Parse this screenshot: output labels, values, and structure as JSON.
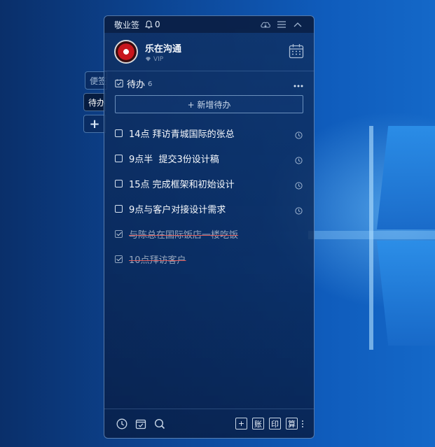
{
  "side_tabs": [
    {
      "label": "便签"
    },
    {
      "label": "待办"
    },
    {
      "label": "+"
    }
  ],
  "titlebar": {
    "brand": "敬业签",
    "notification_count": "0"
  },
  "user": {
    "name": "乐在沟通",
    "level": "VIP"
  },
  "todo": {
    "title": "待办",
    "count": "6",
    "add_label": "+ 新增待办",
    "items": [
      {
        "text": "14点 拜访青城国际的张总",
        "done": false
      },
      {
        "text": "9点半  提交3份设计稿",
        "done": false
      },
      {
        "text": "15点 完成框架和初始设计",
        "done": false
      },
      {
        "text": "9点与客户对接设计需求",
        "done": false
      },
      {
        "text": "与陈总在国际饭店一楼吃饭",
        "done": true
      },
      {
        "text": "10点拜访客户",
        "done": true
      }
    ]
  },
  "footer": {
    "buttons": [
      "+",
      "账",
      "印",
      "算"
    ]
  },
  "colors": {
    "strike": "#e05d5d",
    "panel": "#10306a"
  }
}
